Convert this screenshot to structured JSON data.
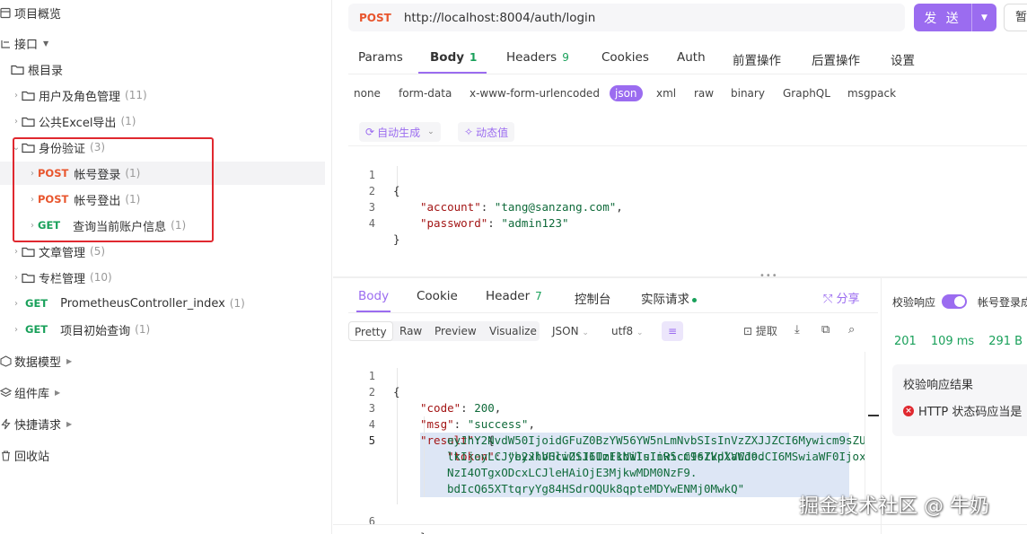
{
  "sidebar": {
    "project_overview": "项目概览",
    "apis_label": "接口",
    "root_label": "根目录",
    "folders": [
      {
        "label": "用户及角色管理",
        "count": "(11)"
      },
      {
        "label": "公共Excel导出",
        "count": "(1)"
      },
      {
        "label": "身份验证",
        "count": "(3)"
      }
    ],
    "auth_endpoints": [
      {
        "method": "POST",
        "label": "帐号登录",
        "count": "(1)"
      },
      {
        "method": "POST",
        "label": "帐号登出",
        "count": "(1)"
      },
      {
        "method": "GET",
        "label": "查询当前账户信息",
        "count": "(1)"
      }
    ],
    "more_folders": [
      {
        "label": "文章管理",
        "count": "(5)"
      },
      {
        "label": "专栏管理",
        "count": "(10)"
      }
    ],
    "endpoints": [
      {
        "method": "GET",
        "label": "PrometheusController_index",
        "count": "(1)"
      },
      {
        "method": "GET",
        "label": "项目初始查询",
        "count": "(1)"
      }
    ],
    "sections": [
      "数据模型",
      "组件库",
      "快捷请求",
      "回收站"
    ]
  },
  "request": {
    "method": "POST",
    "url": "http://localhost:8004/auth/login",
    "send_label": "发 送",
    "save_label": "暂"
  },
  "request_tabs": [
    {
      "label": "Params",
      "badge": ""
    },
    {
      "label": "Body",
      "badge": "1"
    },
    {
      "label": "Headers",
      "badge": "9"
    },
    {
      "label": "Cookies",
      "badge": ""
    },
    {
      "label": "Auth",
      "badge": ""
    },
    {
      "label": "前置操作",
      "badge": ""
    },
    {
      "label": "后置操作",
      "badge": ""
    },
    {
      "label": "设置",
      "badge": ""
    }
  ],
  "body_types": [
    "none",
    "form-data",
    "x-www-form-urlencoded",
    "json",
    "xml",
    "raw",
    "binary",
    "GraphQL",
    "msgpack"
  ],
  "editor_tools": {
    "auto_generate": "自动生成",
    "dynamic_value": "动态值"
  },
  "request_body": {
    "line_numbers": [
      "1",
      "2",
      "3",
      "4"
    ],
    "open": "{",
    "account_key": "\"account\"",
    "account_value": "\"tang@sanzang.com\"",
    "password_key": "\"password\"",
    "password_value": "\"admin123\"",
    "close": "}"
  },
  "response_tabs": [
    {
      "label": "Body",
      "badge": ""
    },
    {
      "label": "Cookie",
      "badge": ""
    },
    {
      "label": "Header",
      "badge": "7"
    },
    {
      "label": "控制台",
      "badge": ""
    },
    {
      "label": "实际请求",
      "badge": ""
    }
  ],
  "share_label": "分享",
  "response_formats": [
    "Pretty",
    "Raw",
    "Preview",
    "Visualize"
  ],
  "response_encoding": {
    "type": "JSON",
    "charset": "utf8",
    "extract": "提取"
  },
  "response_body": {
    "line_numbers": [
      "1",
      "2",
      "3",
      "4",
      "5",
      "6"
    ],
    "open": "{",
    "code_key": "\"code\"",
    "code_value": "200",
    "msg_key": "\"msg\"",
    "msg_value": "\"success\"",
    "result_key": "\"result\"",
    "token_key": "\"token\"",
    "token_lines": [
      "\"eyJhbGciOiJIUzI1NiIsInR5cCI6IkpXVCJ9.",
      "eyJhY2NvdW50IjoidGFuZ0BzYW56YW5nLmNvbSIsInVzZXJJZCI6Mywicm9sZU",
      "lkIjoyLCJyb2xlVHlwZSI6ImFkbWluIiwicm9sZVdlaWdodCI6MSwiaWF0Ijox",
      "NzI4OTgxODcxLCJleHAiOjE3MjkwMDM0NzF9.",
      "bdIcQ65XTtqryYg84HSdrOQUk8qpteMDYwENMj0MwkQ\""
    ],
    "close_result": "}"
  },
  "validation": {
    "toggle_label": "校验响应",
    "endpoint_label": "帐号登录成",
    "status": "201",
    "time": "109 ms",
    "size": "291 B",
    "result_title": "校验响应结果",
    "result_message": "HTTP 状态码应当是"
  },
  "watermark": "掘金技术社区 @ 牛奶",
  "colors": {
    "accent": "#9b6cf0",
    "post": "#e8552d",
    "get": "#19a05a",
    "highlight": "#e0282f"
  }
}
